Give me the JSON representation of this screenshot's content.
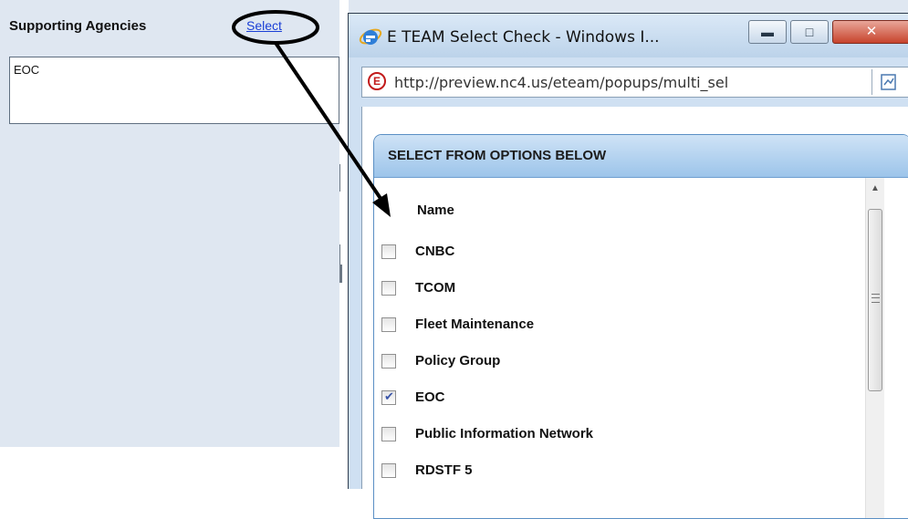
{
  "background_page": {
    "supporting_agencies_label": "Supporting Agencies",
    "select_link": "Select",
    "selected_agencies_value": "EOC"
  },
  "popup": {
    "window_title": "E TEAM Select Check - Windows I...",
    "controls": {
      "minimize": "minimize-icon",
      "maximize": "maximize-icon",
      "close": "close-icon"
    },
    "address_url": "http://preview.nc4.us/eteam/popups/multi_sel",
    "panel_title": "SELECT FROM OPTIONS BELOW",
    "column_header": "Name",
    "options": [
      {
        "label": "CNBC",
        "checked": false
      },
      {
        "label": "TCOM",
        "checked": false
      },
      {
        "label": "Fleet Maintenance",
        "checked": false
      },
      {
        "label": "Policy Group",
        "checked": false
      },
      {
        "label": "EOC",
        "checked": true
      },
      {
        "label": "Public Information Network",
        "checked": false
      },
      {
        "label": "RDSTF 5",
        "checked": false
      }
    ]
  },
  "colors": {
    "link": "#1a3fd6",
    "panel_header": "#9cc4ea",
    "close_button": "#c7432c",
    "check_mark": "#3a55a8"
  }
}
